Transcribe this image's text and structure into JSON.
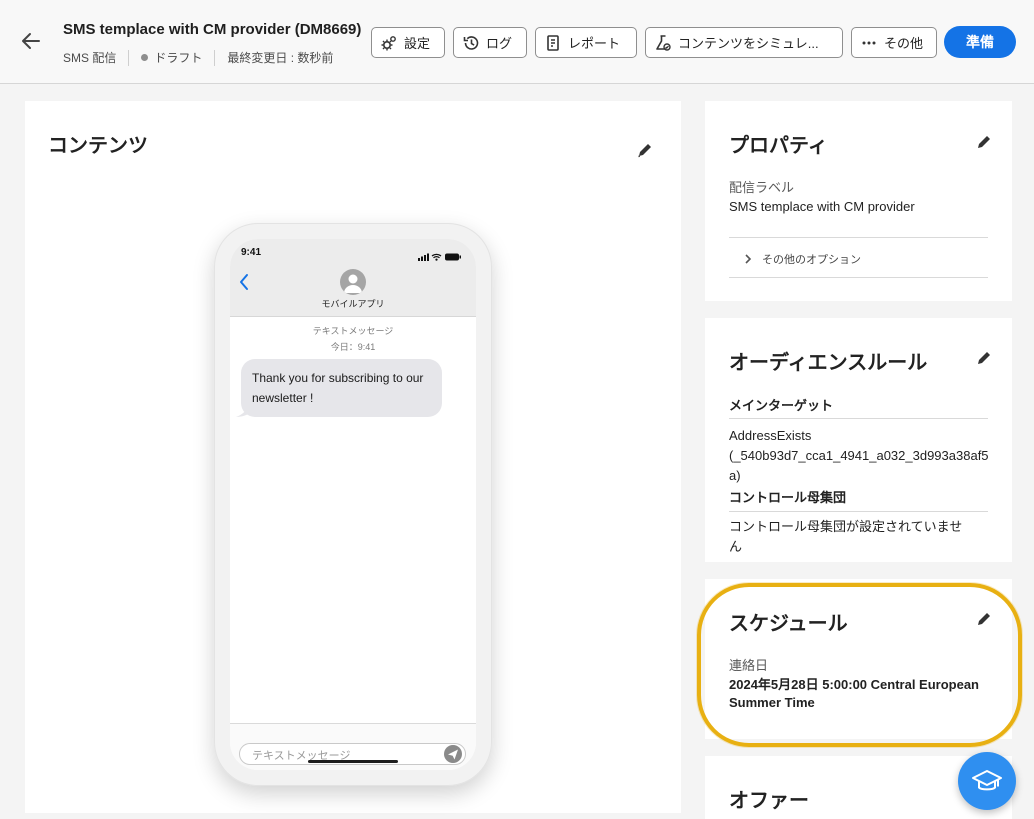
{
  "header": {
    "title": "SMS templace with CM provider (DM8669)",
    "channel": "SMS 配信",
    "status": "ドラフト",
    "last_modified": "最終変更日 : 数秒前",
    "buttons": {
      "settings": "設定",
      "log": "ログ",
      "report": "レポート",
      "simulate": "コンテンツをシミュレ...",
      "more": "その他",
      "prepare": "準備"
    }
  },
  "content": {
    "title": "コンテンツ",
    "phone": {
      "time": "9:41",
      "app_name": "モバイルアプリ",
      "message_type": "テキストメッセージ",
      "message_time": "今日：9:41",
      "message": "Thank you for subscribing to our newsletter !",
      "input_placeholder": "テキストメッセージ"
    }
  },
  "properties": {
    "title": "プロパティ",
    "label_caption": "配信ラベル",
    "label_value": "SMS templace with CM provider",
    "more_options": "その他のオプション"
  },
  "audience": {
    "title": "オーディエンスルール",
    "main_target_heading": "メインターゲット",
    "main_target_value": "AddressExists (_540b93d7_cca1_4941_a032_3d993a38af5a)",
    "control_heading": "コントロール母集団",
    "control_value": "コントロール母集団が設定されていません"
  },
  "schedule": {
    "title": "スケジュール",
    "contact_date_label": "連絡日",
    "contact_date_value": "2024年5月28日 5:00:00 Central European Summer Time"
  },
  "offers": {
    "title": "オファー"
  },
  "colors": {
    "accent": "#1473e6",
    "highlight": "#e8b012",
    "help": "#2f8ff0"
  }
}
